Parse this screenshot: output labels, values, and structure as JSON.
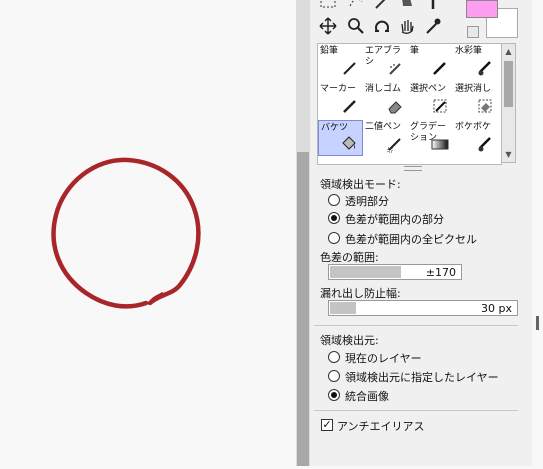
{
  "brushes": [
    {
      "label": "鉛筆",
      "icon": "pencil-icon",
      "selected": false
    },
    {
      "label": "エアブラシ",
      "icon": "airbrush-icon",
      "selected": false
    },
    {
      "label": "筆",
      "icon": "brush-icon",
      "selected": false
    },
    {
      "label": "水彩筆",
      "icon": "watercolor-brush-icon",
      "selected": false
    },
    {
      "label": "マーカー",
      "icon": "marker-icon",
      "selected": false
    },
    {
      "label": "消しゴム",
      "icon": "eraser-icon",
      "selected": false
    },
    {
      "label": "選択ペン",
      "icon": "selection-pen-icon",
      "selected": false
    },
    {
      "label": "選択消し",
      "icon": "selection-eraser-icon",
      "selected": false
    },
    {
      "label": "バケツ",
      "icon": "bucket-icon",
      "selected": true
    },
    {
      "label": "二値ペン",
      "icon": "binary-pen-icon",
      "selected": false
    },
    {
      "label": "グラデーション",
      "icon": "gradation-icon",
      "selected": false
    },
    {
      "label": "ボケボケ",
      "icon": "blur-icon",
      "selected": false
    }
  ],
  "detection_mode": {
    "title": "領域検出モード:",
    "options": [
      {
        "label": "透明部分",
        "selected": false
      },
      {
        "label": "色差が範囲内の部分",
        "selected": true
      },
      {
        "label": "色差が範囲内の全ピクセル",
        "selected": false
      }
    ]
  },
  "color_range": {
    "label": "色差の範囲:",
    "value": "±170",
    "fill_fraction": 0.54
  },
  "leak_prevention": {
    "label": "漏れ出し防止幅:",
    "value": "30 px",
    "fill_fraction": 0.14
  },
  "detection_source": {
    "title": "領域検出元:",
    "options": [
      {
        "label": "現在のレイヤー",
        "selected": false
      },
      {
        "label": "領域検出元に指定したレイヤー",
        "selected": false
      },
      {
        "label": "統合画像",
        "selected": true
      }
    ]
  },
  "antialias": {
    "label": "アンチエイリアス",
    "checked": true
  },
  "colors": {
    "primary": "#ff9df0",
    "secondary": "#ffffff",
    "stroke": "#a8262a"
  }
}
